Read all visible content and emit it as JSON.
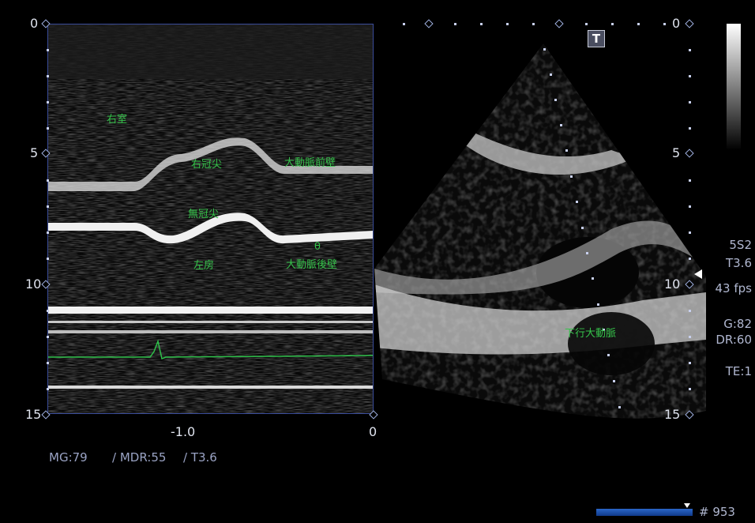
{
  "mmode": {
    "depth_ticks": [
      "0",
      "5",
      "10",
      "15"
    ],
    "time_ticks": [
      "-1.0",
      "0"
    ],
    "labels": {
      "rv": "右室",
      "rcc": "右冠尖",
      "aortic_ant": "大動脈前壁",
      "ncc": "無冠尖",
      "la": "左房",
      "theta": "θ",
      "aortic_post": "大動脈後壁"
    }
  },
  "twod": {
    "depth_ticks": [
      "0",
      "5",
      "10",
      "15"
    ],
    "label_desc_aorta": "下行大動脈",
    "t_badge": "T"
  },
  "footer": {
    "mg": "MG:79",
    "mdr": "/ MDR:55",
    "t": "/ T3.6",
    "frame": "# 953",
    "progress_fraction": 0.95
  },
  "side_info": {
    "probe": "5S2",
    "t": "T3.6",
    "fps": "43 fps",
    "g": "G:82",
    "dr": "DR:60",
    "te": "TE:1"
  }
}
